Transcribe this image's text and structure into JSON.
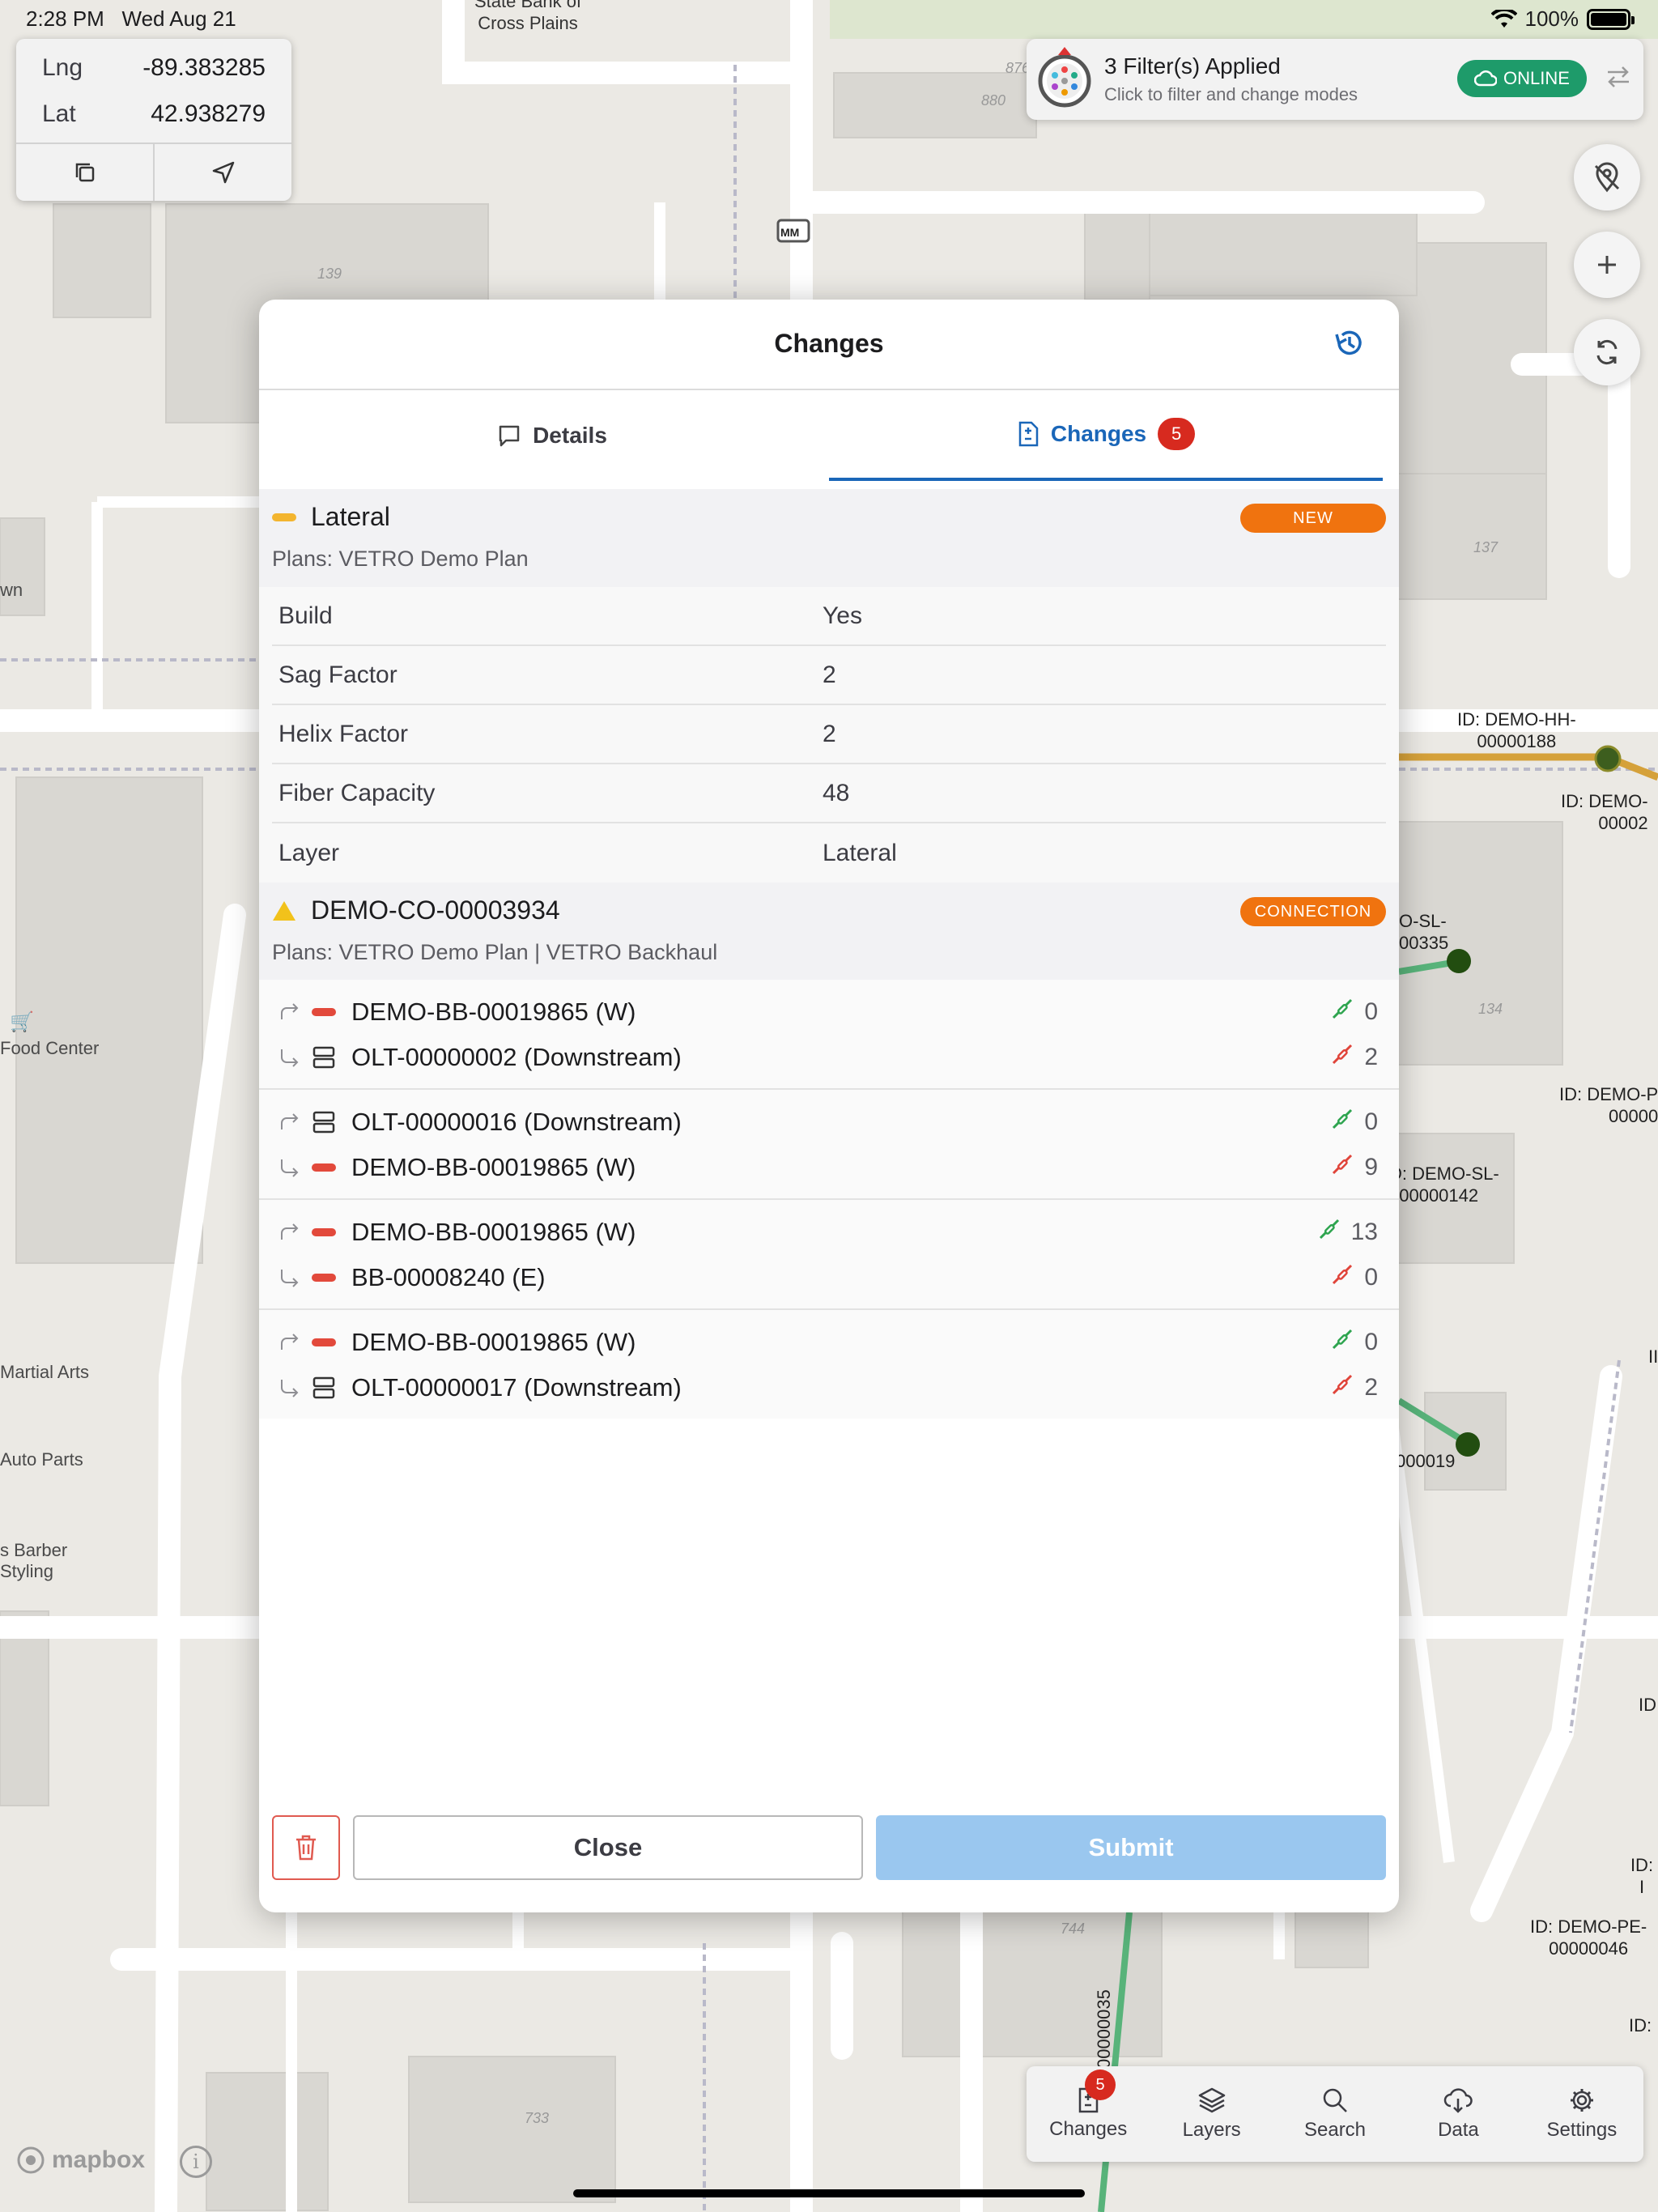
{
  "status_bar": {
    "time": "2:28 PM",
    "date": "Wed Aug 21",
    "battery": "100%"
  },
  "coords": {
    "lng_label": "Lng",
    "lng_value": "-89.383285",
    "lat_label": "Lat",
    "lat_value": "42.938279",
    "copy_icon": "copy-icon",
    "locate_icon": "navigation-arrow-icon"
  },
  "filter": {
    "title": "3 Filter(s) Applied",
    "subtitle": "Click to filter and change modes",
    "status": "ONLINE"
  },
  "map": {
    "bank_label": "State Bank of\nCross Plains",
    "marker_mm": "MM",
    "labels": {
      "hh188": "ID: DEMO-HH-\n00000188",
      "demo_right1": "ID: DEMO-\n00002",
      "sl335": "O-SL-\n00335",
      "demo_pe": "ID: DEMO-P\n00000",
      "sl142": "D: DEMO-SL-\n000000142",
      "o019": "000019",
      "pe046": "ID: DEMO-PE-\n00000046",
      "vertical_35": "00000035",
      "id_short1": "ID: I",
      "id_short2": "ID:",
      "id_short3": "ID",
      "id_short4": "II"
    },
    "poi": {
      "food": "Food Center",
      "martial": "Martial Arts",
      "auto": "Auto Parts",
      "barber": "s Barber\nStyling",
      "town": "wn"
    },
    "building_numbers": {
      "b139": "139",
      "b137": "137",
      "b134": "134",
      "b880": "880",
      "b876": "876",
      "b744": "744",
      "b733": "733"
    },
    "attribution": "mapbox",
    "info": "i"
  },
  "modal": {
    "title": "Changes",
    "history_icon": "history-icon",
    "tabs": [
      {
        "label": "Details"
      },
      {
        "label": "Changes",
        "badge": "5"
      }
    ],
    "lateral": {
      "name": "Lateral",
      "tag": "NEW",
      "plans": "Plans: VETRO Demo Plan",
      "props": [
        {
          "key": "Build",
          "value": "Yes"
        },
        {
          "key": "Sag Factor",
          "value": "2"
        },
        {
          "key": "Helix Factor",
          "value": "2"
        },
        {
          "key": "Fiber Capacity",
          "value": "48"
        },
        {
          "key": "Layer",
          "value": "Lateral"
        }
      ]
    },
    "connection": {
      "name": "DEMO-CO-00003934",
      "tag": "CONNECTION",
      "plans": "Plans: VETRO Demo Plan  |  VETRO Backhaul",
      "groups": [
        {
          "from": "DEMO-BB-00019865  (W)",
          "from_icon": "cable",
          "from_count": "0",
          "to": "OLT-00000002  (Downstream)",
          "to_icon": "device",
          "to_count": "2"
        },
        {
          "from": "OLT-00000016  (Downstream)",
          "from_icon": "device",
          "from_count": "0",
          "to": "DEMO-BB-00019865  (W)",
          "to_icon": "cable",
          "to_count": "9"
        },
        {
          "from": "DEMO-BB-00019865  (W)",
          "from_icon": "cable",
          "from_count": "13",
          "to": "BB-00008240  (E)",
          "to_icon": "cable",
          "to_count": "0"
        },
        {
          "from": "DEMO-BB-00019865  (W)",
          "from_icon": "cable",
          "from_count": "0",
          "to": "OLT-00000017  (Downstream)",
          "to_icon": "device",
          "to_count": "2"
        }
      ]
    },
    "buttons": {
      "close": "Close",
      "submit": "Submit"
    }
  },
  "bottom_nav": {
    "items": [
      {
        "label": "Changes",
        "badge": "5"
      },
      {
        "label": "Layers"
      },
      {
        "label": "Search"
      },
      {
        "label": "Data"
      },
      {
        "label": "Settings"
      }
    ]
  },
  "colors": {
    "accent": "#1a66b8",
    "badge_red": "#d72a1f",
    "tag_orange": "#f0730f",
    "online_green": "#1e9b6a",
    "submit_disabled": "#9ac7ef"
  }
}
